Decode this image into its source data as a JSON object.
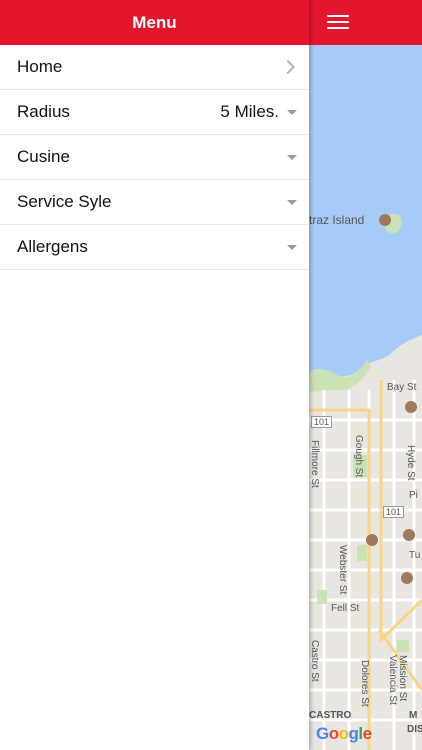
{
  "drawer": {
    "title": "Menu",
    "items": [
      {
        "label": "Home",
        "value": "",
        "control": "chevron-right"
      },
      {
        "label": "Radius",
        "value": "5 Miles.",
        "control": "dropdown-caret"
      },
      {
        "label": "Cusine",
        "value": "",
        "control": "dropdown-caret"
      },
      {
        "label": "Service Syle",
        "value": "",
        "control": "dropdown-caret"
      },
      {
        "label": "Allergens",
        "value": "",
        "control": "dropdown-caret"
      }
    ]
  },
  "map": {
    "labels": {
      "island": "traz Island",
      "bay_st": "Bay St",
      "hwy101a": "101",
      "hwy101b": "101",
      "gough_st": "Gough St",
      "hyde_st": "Hyde St",
      "fillmore_st": "Fillmore St",
      "webster_st": "Webster St",
      "fell_st": "Fell St",
      "castro": "CASTRO",
      "dolores_st": "Dolores St",
      "mission_st": "Mission St",
      "valencia_st": "Valencia St",
      "castro_st": "Castro St",
      "tu": "Tu",
      "pi": "Pi",
      "md": "M",
      "dis": "DIS"
    },
    "attribution": "Google"
  },
  "colors": {
    "header_red": "#e4162e",
    "water": "#a7cbf7",
    "land": "#e9e6e1",
    "park": "#c9e3b5"
  }
}
